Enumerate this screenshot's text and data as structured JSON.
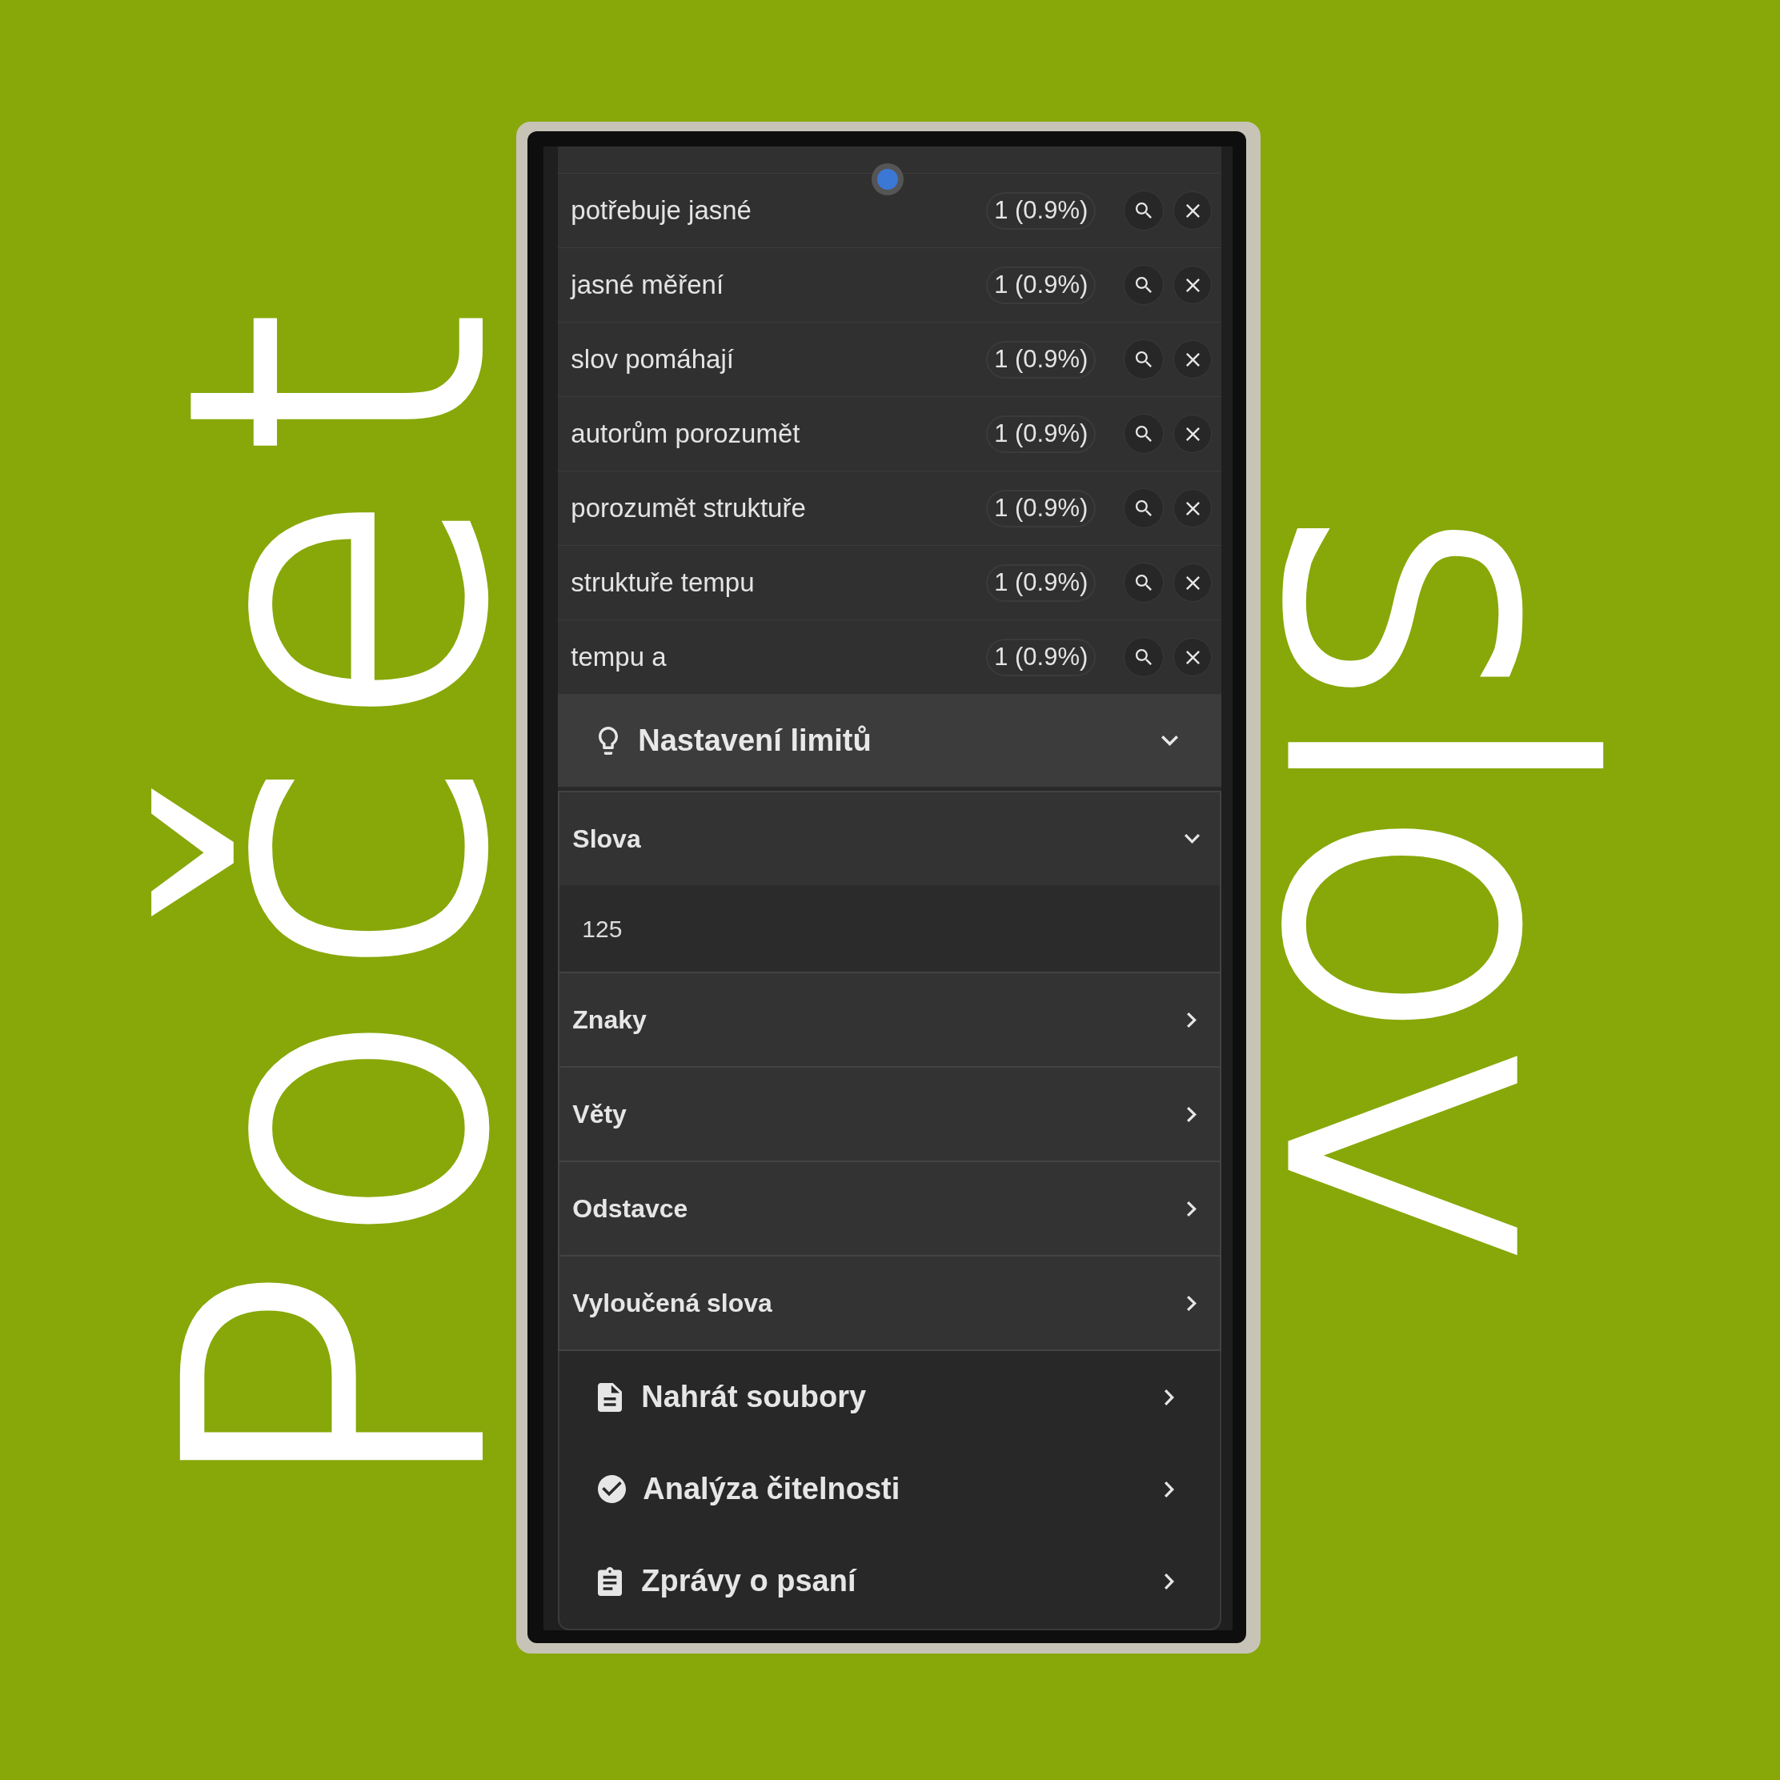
{
  "headline": {
    "left": "Počet",
    "right": "slov"
  },
  "word_list": {
    "rows": [
      {
        "phrase": "potřebuje jasné",
        "count": "1 (0.9%)"
      },
      {
        "phrase": "jasné měření",
        "count": "1 (0.9%)"
      },
      {
        "phrase": "slov pomáhají",
        "count": "1 (0.9%)"
      },
      {
        "phrase": "autorům porozumět",
        "count": "1 (0.9%)"
      },
      {
        "phrase": "porozumět struktuře",
        "count": "1 (0.9%)"
      },
      {
        "phrase": "struktuře tempu",
        "count": "1 (0.9%)"
      },
      {
        "phrase": "tempu a",
        "count": "1 (0.9%)"
      }
    ]
  },
  "limits_panel": {
    "title": "Nastavení limitů",
    "expanded": true,
    "sections": [
      {
        "label": "Slova",
        "expanded": true,
        "value": "125"
      },
      {
        "label": "Znaky",
        "expanded": false
      },
      {
        "label": "Věty",
        "expanded": false
      },
      {
        "label": "Odstavce",
        "expanded": false
      },
      {
        "label": "Vyloučená slova",
        "expanded": false
      }
    ]
  },
  "menu": [
    {
      "label": "Nahrát soubory"
    },
    {
      "label": "Analýza čitelnosti"
    },
    {
      "label": "Zprávy o psaní"
    }
  ]
}
